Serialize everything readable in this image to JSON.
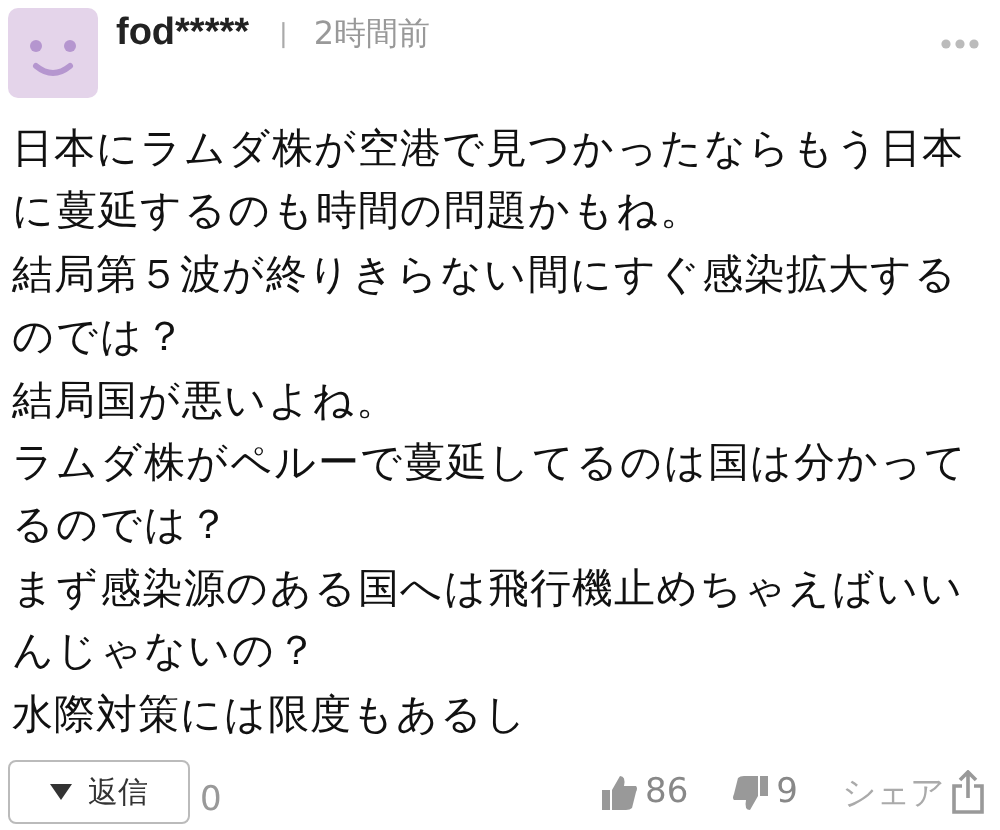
{
  "comment": {
    "user": "fod*****",
    "separator": "|",
    "time": "2時間前",
    "paragraphs": [
      "日本にラムダ株が空港で見つかったならもう日本に蔓延するのも時間の問題かもね。",
      "結局第５波が終りきらない間にすぐ感染拡大するのでは？",
      "結局国が悪いよね。",
      "ラムダ株がペルーで蔓延してるのは国は分かってるのでは？",
      "まず感染源のある国へは飛行機止めちゃえばいいんじゃないの？",
      "水際対策には限度もあるし"
    ]
  },
  "footer": {
    "reply_label": "返信",
    "reply_count": "0",
    "likes": "86",
    "dislikes": "9",
    "share": "シェア"
  }
}
